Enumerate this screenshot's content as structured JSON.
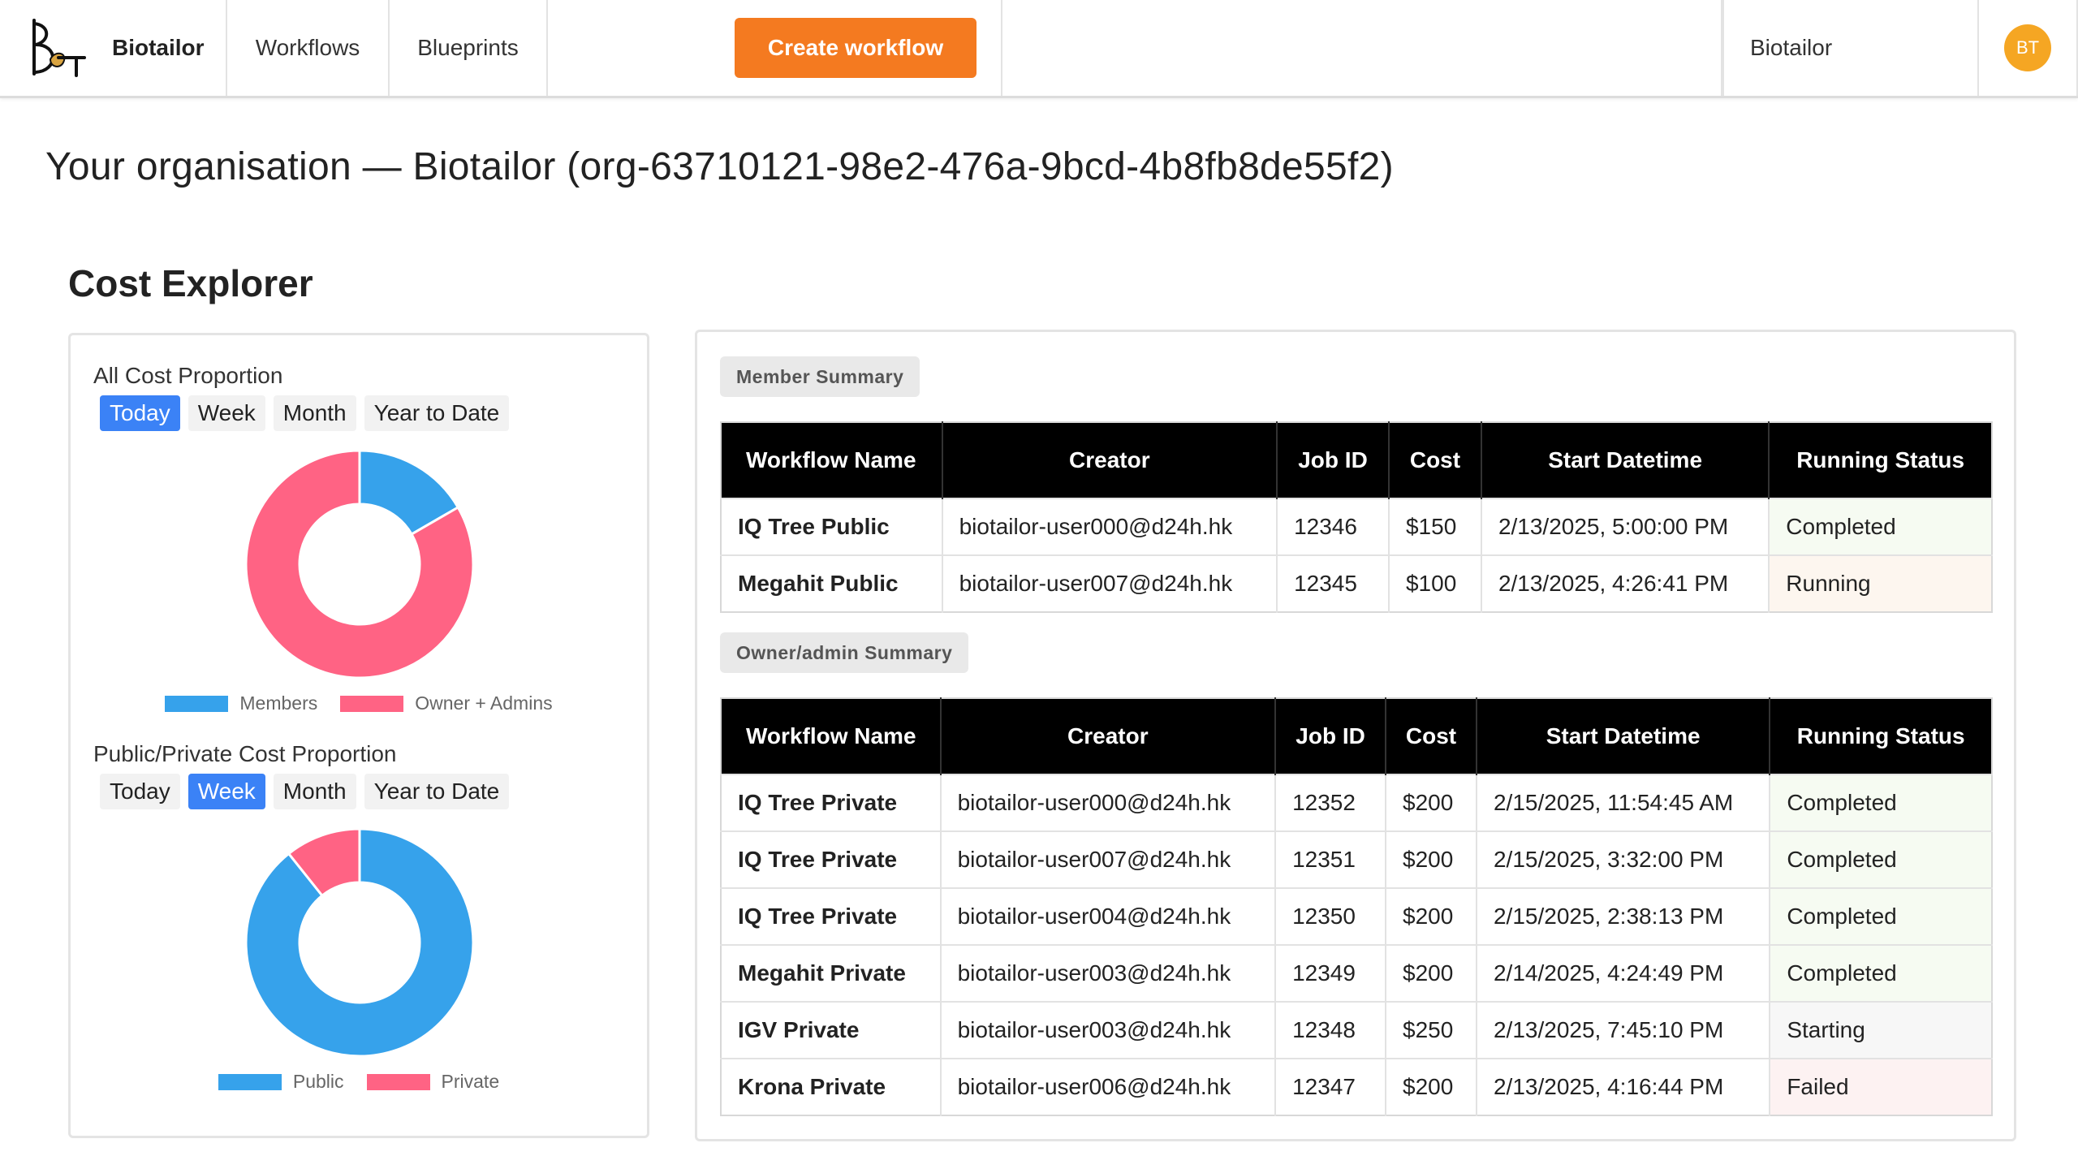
{
  "nav": {
    "brand": "Biotailor",
    "workflows": "Workflows",
    "blueprints": "Blueprints",
    "create_workflow": "Create workflow",
    "org_name": "Biotailor",
    "avatar_initials": "BT"
  },
  "page": {
    "org_title": "Your organisation — Biotailor (org-63710121-98e2-476a-9bcd-4b8fb8de55f2)",
    "section_title": "Cost Explorer"
  },
  "charts": {
    "all_cost": {
      "label": "All Cost Proportion",
      "tabs": [
        "Today",
        "Week",
        "Month",
        "Year to Date"
      ],
      "active_tab": "Today",
      "legend": [
        "Members",
        "Owner + Admins"
      ],
      "colors": [
        "#36a2eb",
        "#ff6384"
      ]
    },
    "public_private": {
      "label": "Public/Private Cost Proportion",
      "tabs": [
        "Today",
        "Week",
        "Month",
        "Year to Date"
      ],
      "active_tab": "Week",
      "legend": [
        "Public",
        "Private"
      ],
      "colors": [
        "#36a2eb",
        "#ff6384"
      ]
    }
  },
  "chart_data": [
    {
      "type": "pie",
      "title": "All Cost Proportion",
      "categories": [
        "Members",
        "Owner + Admins"
      ],
      "values": [
        250,
        1250
      ]
    },
    {
      "type": "pie",
      "title": "Public/Private Cost Proportion",
      "categories": [
        "Public",
        "Private"
      ],
      "values": [
        1250,
        150
      ]
    }
  ],
  "member_summary": {
    "label": "Member Summary",
    "headers": [
      "Workflow Name",
      "Creator",
      "Job ID",
      "Cost",
      "Start Datetime",
      "Running Status"
    ],
    "rows": [
      [
        "IQ Tree Public",
        "biotailor-user000@d24h.hk",
        "12346",
        "$150",
        "2/13/2025, 5:00:00 PM",
        "Completed"
      ],
      [
        "Megahit Public",
        "biotailor-user007@d24h.hk",
        "12345",
        "$100",
        "2/13/2025, 4:26:41 PM",
        "Running"
      ]
    ]
  },
  "owner_summary": {
    "label": "Owner/admin Summary",
    "headers": [
      "Workflow Name",
      "Creator",
      "Job ID",
      "Cost",
      "Start Datetime",
      "Running Status"
    ],
    "rows": [
      [
        "IQ Tree Private",
        "biotailor-user000@d24h.hk",
        "12352",
        "$200",
        "2/15/2025, 11:54:45 AM",
        "Completed"
      ],
      [
        "IQ Tree Private",
        "biotailor-user007@d24h.hk",
        "12351",
        "$200",
        "2/15/2025, 3:32:00 PM",
        "Completed"
      ],
      [
        "IQ Tree Private",
        "biotailor-user004@d24h.hk",
        "12350",
        "$200",
        "2/15/2025, 2:38:13 PM",
        "Completed"
      ],
      [
        "Megahit Private",
        "biotailor-user003@d24h.hk",
        "12349",
        "$200",
        "2/14/2025, 4:24:49 PM",
        "Completed"
      ],
      [
        "IGV Private",
        "biotailor-user003@d24h.hk",
        "12348",
        "$250",
        "2/13/2025, 7:45:10 PM",
        "Starting"
      ],
      [
        "Krona Private",
        "biotailor-user006@d24h.hk",
        "12347",
        "$200",
        "2/13/2025, 4:16:44 PM",
        "Failed"
      ]
    ]
  }
}
